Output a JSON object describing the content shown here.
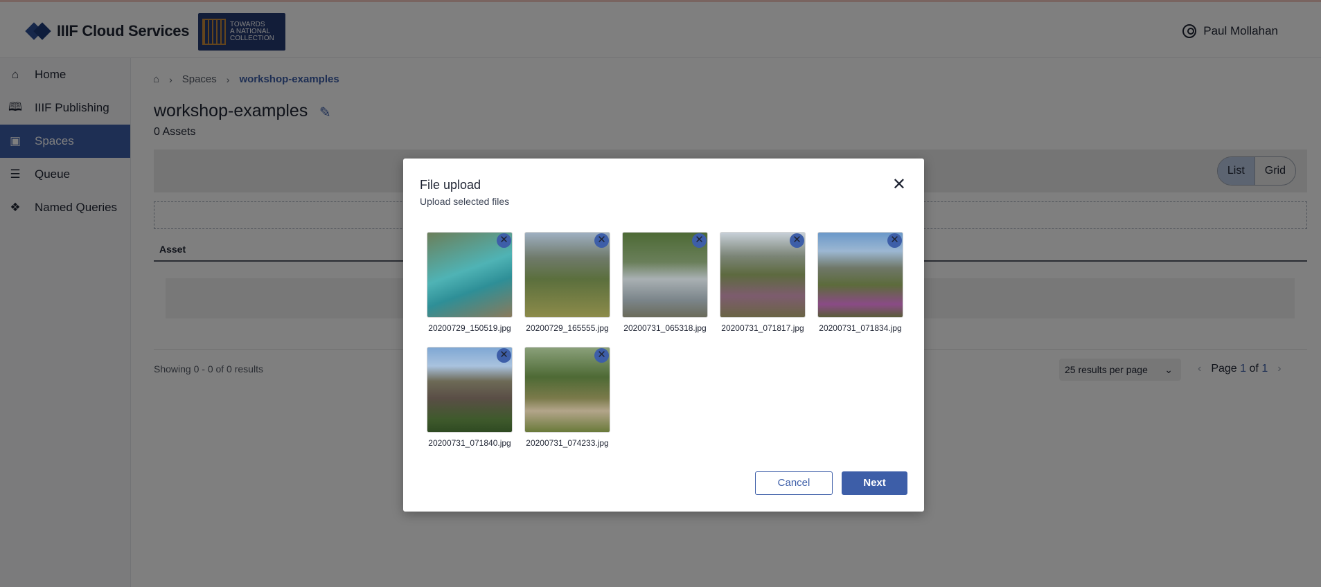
{
  "header": {
    "brand_name": "IIIF Cloud Services",
    "partner_lines": [
      "Towards",
      "A National",
      "Collection"
    ],
    "user_name": "Paul Mollahan"
  },
  "sidebar": {
    "items": [
      {
        "label": "Home",
        "icon": "home-icon"
      },
      {
        "label": "IIIF Publishing",
        "icon": "book-icon"
      },
      {
        "label": "Spaces",
        "icon": "images-icon",
        "active": true
      },
      {
        "label": "Queue",
        "icon": "list-icon"
      },
      {
        "label": "Named Queries",
        "icon": "query-icon"
      }
    ]
  },
  "breadcrumb": {
    "spaces": "Spaces",
    "current": "workshop-examples"
  },
  "page": {
    "title": "workshop-examples",
    "assets_count": "0 Assets",
    "view_list": "List",
    "view_grid": "Grid",
    "column_asset": "Asset",
    "showing": "Showing 0 - 0 of 0 results",
    "per_page": "25 results per page",
    "page_label": "Page",
    "page_current": "1",
    "page_of": "of",
    "page_total": "1"
  },
  "modal": {
    "title": "File upload",
    "subtitle": "Upload selected files",
    "cancel_label": "Cancel",
    "next_label": "Next",
    "files": [
      {
        "name": "20200729_150519.jpg"
      },
      {
        "name": "20200729_165555.jpg"
      },
      {
        "name": "20200731_065318.jpg"
      },
      {
        "name": "20200731_071817.jpg"
      },
      {
        "name": "20200731_071834.jpg"
      },
      {
        "name": "20200731_071840.jpg"
      },
      {
        "name": "20200731_074233.jpg"
      }
    ]
  },
  "colors": {
    "accent": "#3d5ea8",
    "overlay": "#000000"
  }
}
